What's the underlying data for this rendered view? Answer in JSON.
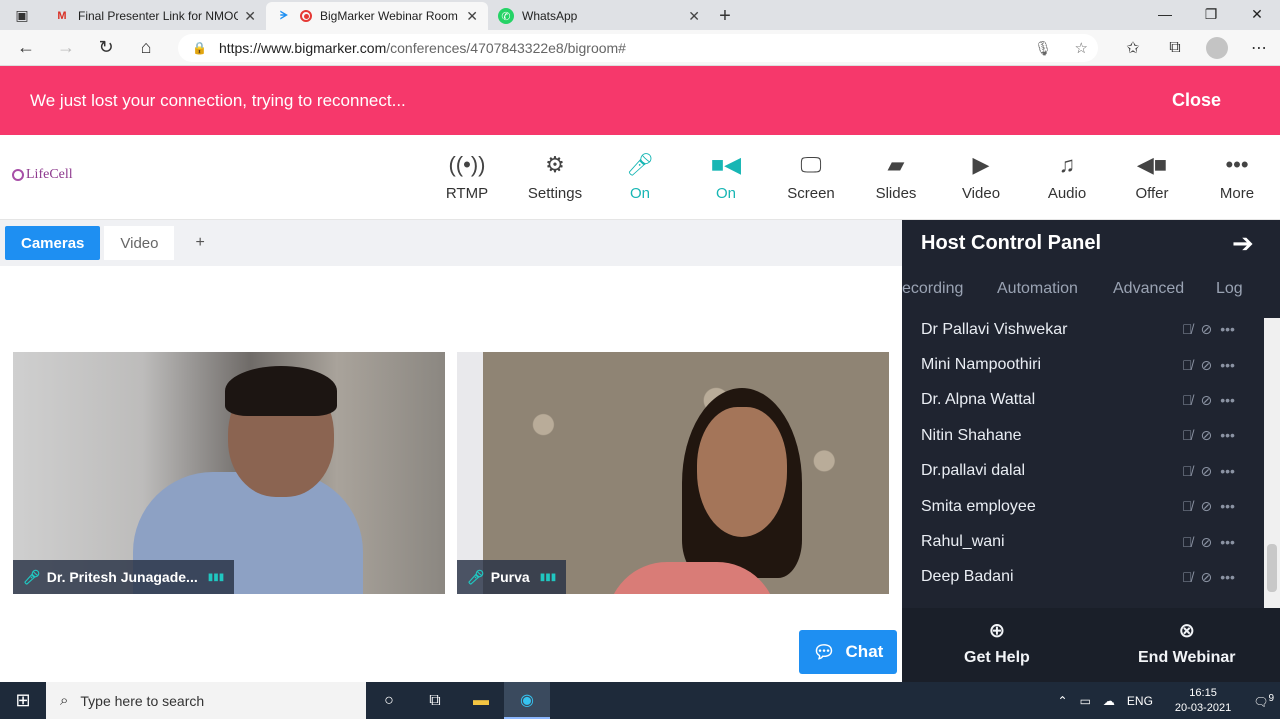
{
  "browser": {
    "tabs": [
      {
        "title": "Final Presenter Link for NMOGS",
        "icon": "gmail-icon"
      },
      {
        "title": "BigMarker Webinar Room",
        "icon": "record-icon"
      },
      {
        "title": "WhatsApp",
        "icon": "whatsapp-icon"
      }
    ],
    "url_host": "https://www.bigmarker.com",
    "url_path": "/conferences/4707843322e8/bigroom#"
  },
  "banner": {
    "message": "We just lost your connection, trying to reconnect...",
    "close_label": "Close",
    "color": "#f6386b"
  },
  "app": {
    "logo_text": "LifeCell",
    "toolbar": [
      {
        "label": "RTMP",
        "icon": "broadcast-icon",
        "state": "normal"
      },
      {
        "label": "Settings",
        "icon": "gear-icon",
        "state": "normal"
      },
      {
        "label": "On",
        "icon": "microphone-icon",
        "state": "on"
      },
      {
        "label": "On",
        "icon": "camera-icon",
        "state": "on"
      },
      {
        "label": "Screen",
        "icon": "monitor-icon",
        "state": "normal"
      },
      {
        "label": "Slides",
        "icon": "slides-icon",
        "state": "normal"
      },
      {
        "label": "Video",
        "icon": "video-play-icon",
        "state": "normal"
      },
      {
        "label": "Audio",
        "icon": "music-note-icon",
        "state": "normal"
      },
      {
        "label": "Offer",
        "icon": "tag-icon",
        "state": "normal"
      },
      {
        "label": "More",
        "icon": "more-dots-icon",
        "state": "normal"
      }
    ],
    "accent": "#17b6b4"
  },
  "stage": {
    "tabs": {
      "cameras": "Cameras",
      "video": "Video",
      "add": "+"
    },
    "cameras": [
      {
        "name": "Dr. Pritesh Junagade..."
      },
      {
        "name": "Purva"
      }
    ],
    "chat_label": "Chat"
  },
  "panel": {
    "title": "Host Control Panel",
    "tabs": [
      "ecording",
      "Automation",
      "Advanced",
      "Log"
    ],
    "attendees": [
      "Dr Pallavi Vishwekar",
      "Mini Nampoothiri",
      "Dr. Alpna Wattal",
      "Nitin Shahane",
      "Dr.pallavi dalal",
      "Smita employee",
      "Rahul_wani",
      "Deep Badani"
    ],
    "help_label": "Get Help",
    "end_label": "End Webinar"
  },
  "taskbar": {
    "search_placeholder": "Type here to search",
    "lang": "ENG",
    "time": "16:15",
    "date": "20-03-2021",
    "notifications": "9"
  }
}
